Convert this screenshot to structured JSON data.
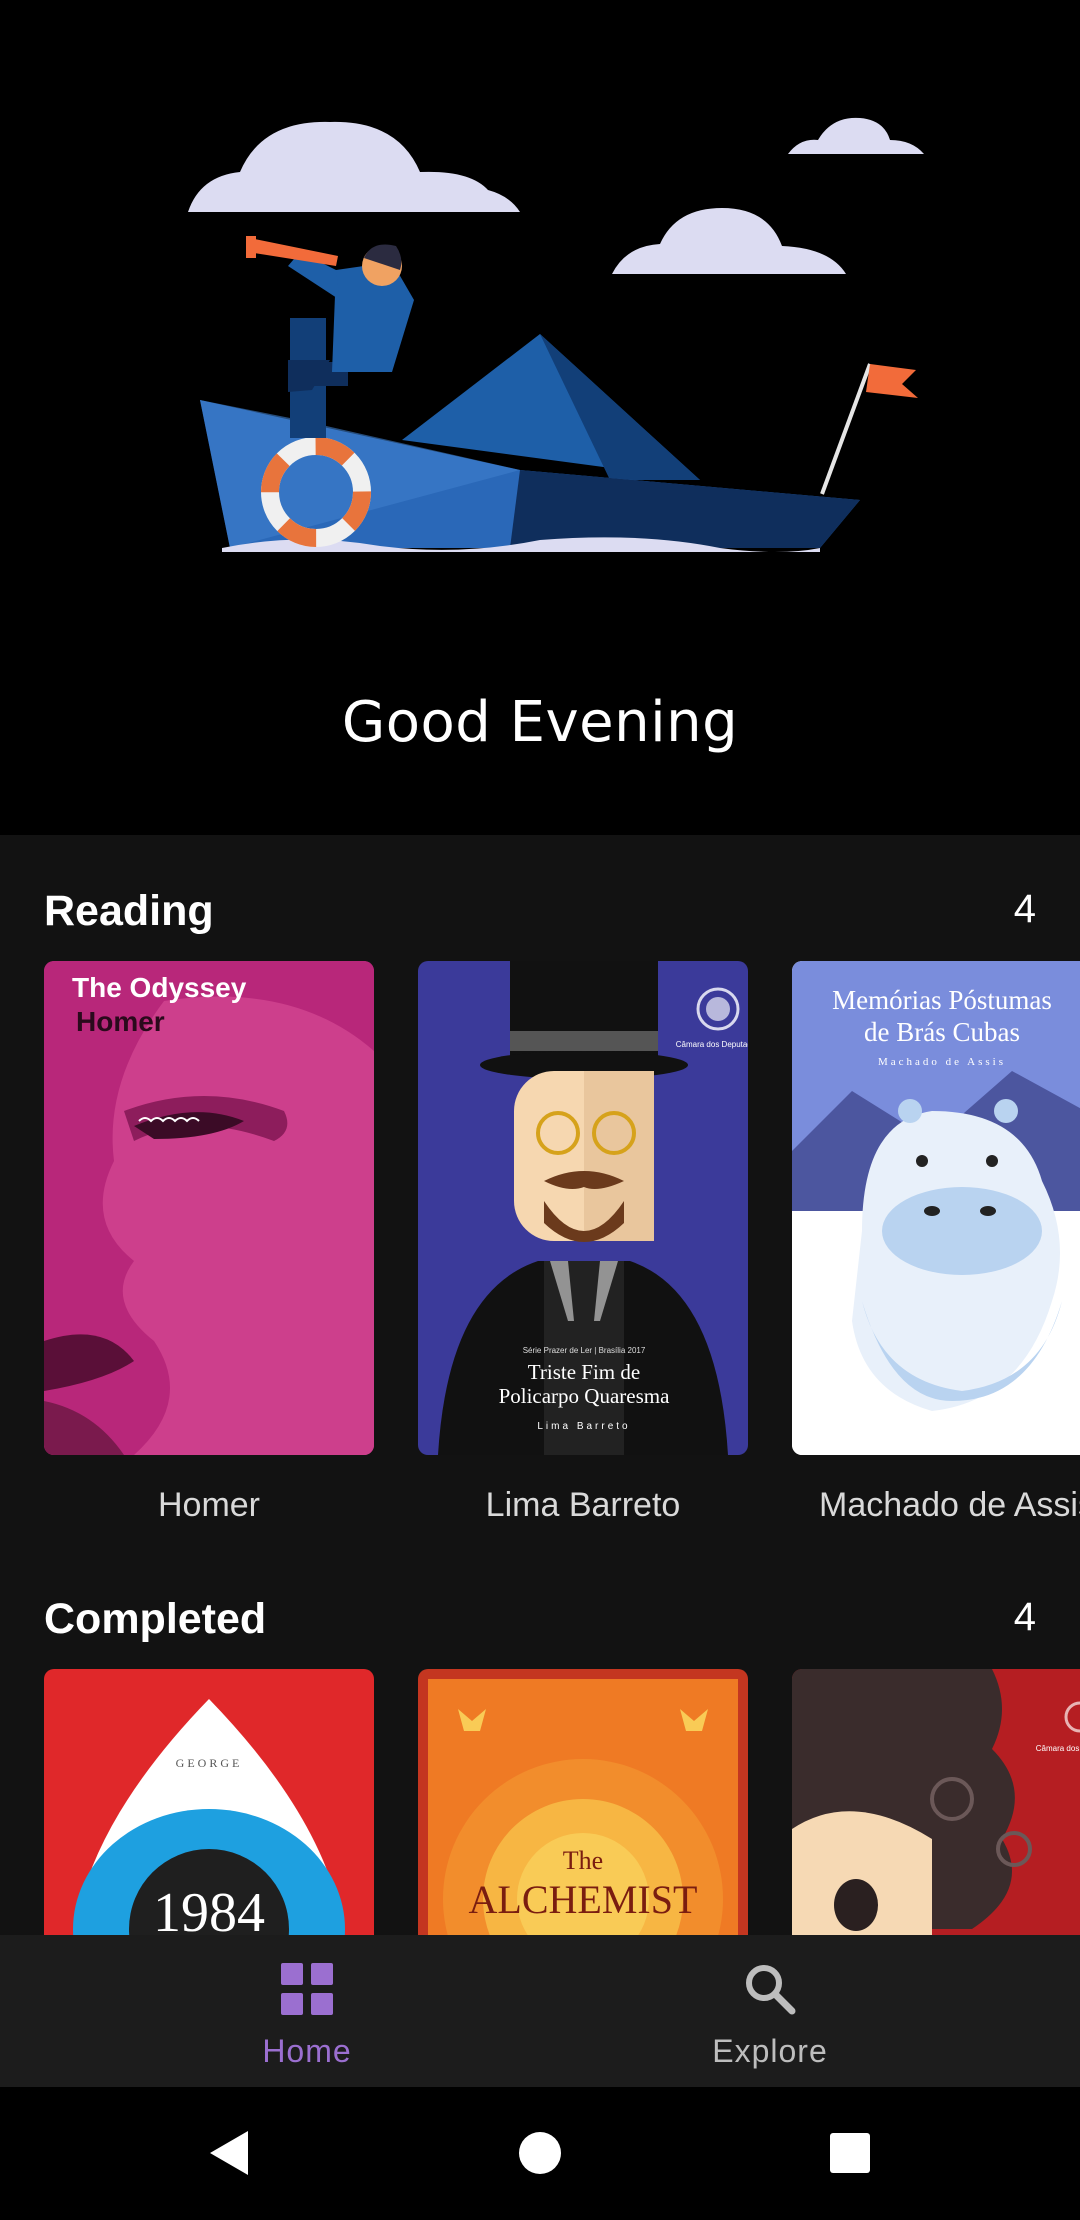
{
  "greeting": "Good Evening",
  "sections": [
    {
      "title": "Reading",
      "count": "4",
      "books": [
        {
          "author": "Homer",
          "cover_title": "The Odyssey",
          "cover_author": "Homer"
        },
        {
          "author": "Lima Barreto",
          "cover_title": "Triste Fim de Policarpo Quaresma",
          "cover_title_line1": "Triste Fim de",
          "cover_title_line2": "Policarpo Quaresma",
          "cover_series": "Série Prazer de Ler | Brasília 2017",
          "cover_author": "Lima Barreto",
          "cover_publisher": "Câmara dos Deputados"
        },
        {
          "author": "Machado de Assis",
          "cover_title_line1": "Memórias Póstumas",
          "cover_title_line2": "de Brás Cubas",
          "cover_author": "Machado de Assis"
        }
      ]
    },
    {
      "title": "Completed",
      "count": "4",
      "books": [
        {
          "cover_top_text": "GEORGE",
          "cover_title": "1984"
        },
        {
          "cover_title_line1": "The",
          "cover_title_line2": "ALCHEMIST"
        },
        {
          "cover_publisher": "Câmara dos Deputados"
        }
      ]
    }
  ],
  "bottom_nav": {
    "items": [
      {
        "label": "Home",
        "icon": "dashboard-icon",
        "active": true
      },
      {
        "label": "Explore",
        "icon": "search-icon",
        "active": false
      }
    ],
    "active_color": "#9b6fd0",
    "inactive_color": "#bdbdbd"
  },
  "system_nav": {
    "back": "back-icon",
    "home": "home-circle-icon",
    "recents": "recents-square-icon"
  }
}
